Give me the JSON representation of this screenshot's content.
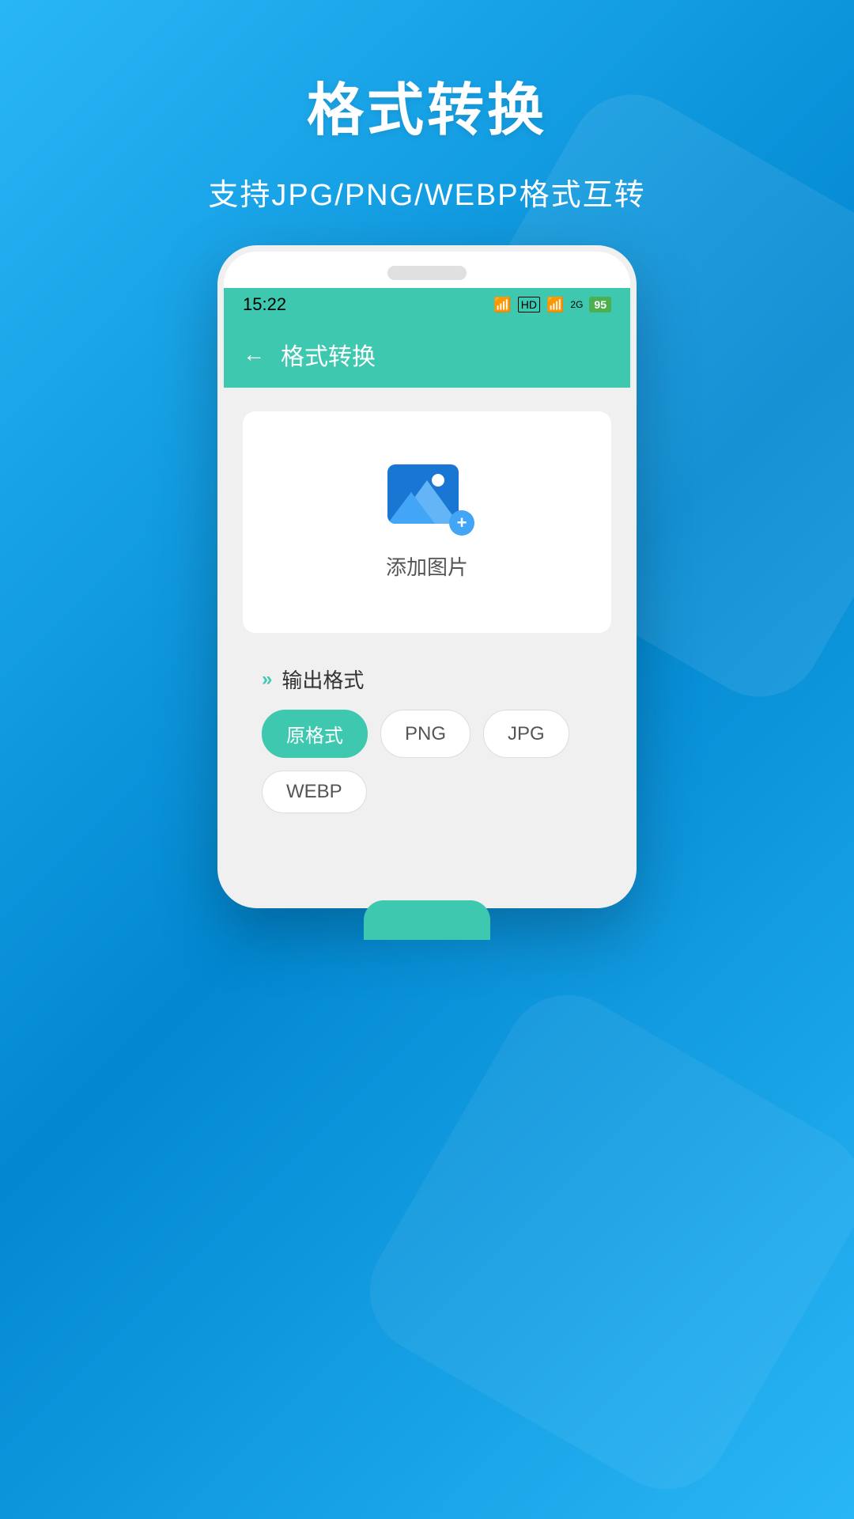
{
  "background": {
    "gradient_start": "#29b6f6",
    "gradient_end": "#0288d1"
  },
  "header": {
    "main_title": "格式转换",
    "sub_title": "支持JPG/PNG/WEBP格式互转"
  },
  "phone": {
    "status_bar": {
      "time": "15:22",
      "battery": "95",
      "wifi_icon": "WiFi",
      "signal_icons": "4G 2G"
    },
    "toolbar": {
      "title": "格式转换",
      "back_label": "←"
    },
    "upload_card": {
      "text": "添加图片"
    },
    "output_section": {
      "label": "输出格式",
      "buttons": [
        {
          "label": "原格式",
          "active": true
        },
        {
          "label": "PNG",
          "active": false
        },
        {
          "label": "JPG",
          "active": false
        },
        {
          "label": "WEBP",
          "active": false
        }
      ]
    }
  }
}
